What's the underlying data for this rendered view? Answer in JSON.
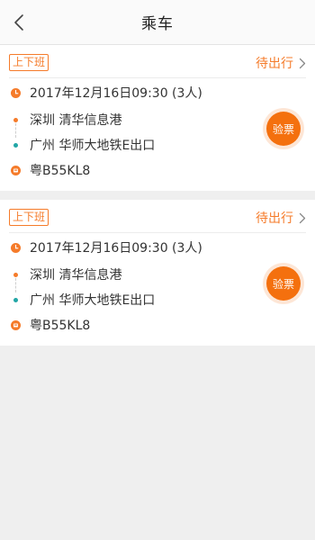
{
  "header": {
    "title": "乘车",
    "back_icon": "chevron-left-icon"
  },
  "colors": {
    "accent": "#f57b2a",
    "button": "#f4700e",
    "teal_dot": "#22a6a6",
    "background": "#efefef"
  },
  "trips": [
    {
      "tag": "上下班",
      "status": "待出行",
      "datetime": "2017年12月16日09:30 (3人)",
      "from": "深圳  清华信息港",
      "to": "广州  华师大地铁E出口",
      "plate": "粤B55KL8",
      "verify_label": "验票"
    },
    {
      "tag": "上下班",
      "status": "待出行",
      "datetime": "2017年12月16日09:30 (3人)",
      "from": "深圳  清华信息港",
      "to": "广州  华师大地铁E出口",
      "plate": "粤B55KL8",
      "verify_label": "验票"
    }
  ]
}
